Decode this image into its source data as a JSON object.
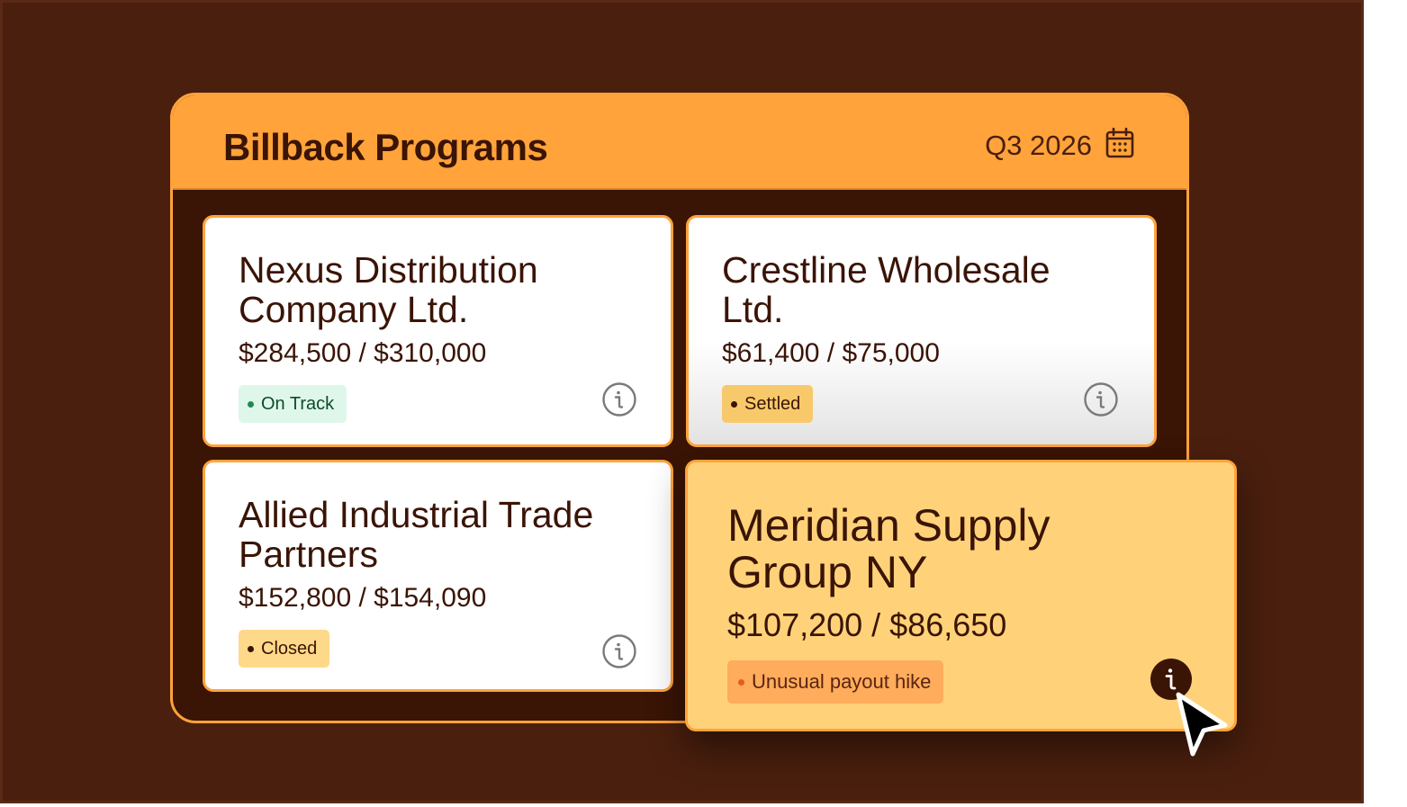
{
  "header": {
    "title": "Billback Programs",
    "period": "Q3 2026",
    "calendar_icon": "calendar-icon"
  },
  "cards": [
    {
      "name_line1": "Nexus Distribution",
      "name_line2": "Company Ltd.",
      "amount": "$284,500 / $310,000",
      "status": "On Track",
      "status_bg": "#dff7ea",
      "status_dot": "#1f8a50",
      "status_color": "#0f4a2a"
    },
    {
      "name_line1": "Crestline Wholesale",
      "name_line2": "Ltd.",
      "amount": "$61,400 / $75,000",
      "status": "Settled",
      "status_bg": "#f7c96a",
      "status_dot": "#3a1405",
      "status_color": "#3a1405"
    },
    {
      "name_line1": "Allied Industrial Trade",
      "name_line2": "Partners",
      "amount": "$152,800 / $154,090",
      "status": "Closed",
      "status_bg": "#ffd98a",
      "status_dot": "#3a1405",
      "status_color": "#3a1405"
    },
    {
      "name_line1": "Meridian Supply",
      "name_line2": "Group NY",
      "amount": "$107,200 / $86,650",
      "status": "Unusual payout hike",
      "status_bg": "#ffac5c",
      "status_dot": "#e85a1c",
      "status_color": "#5a2410"
    }
  ],
  "colors": {
    "accent": "#ffa33a",
    "background": "#4a1f0e",
    "panel": "#3a1405",
    "highlight_card": "#ffd27a"
  }
}
